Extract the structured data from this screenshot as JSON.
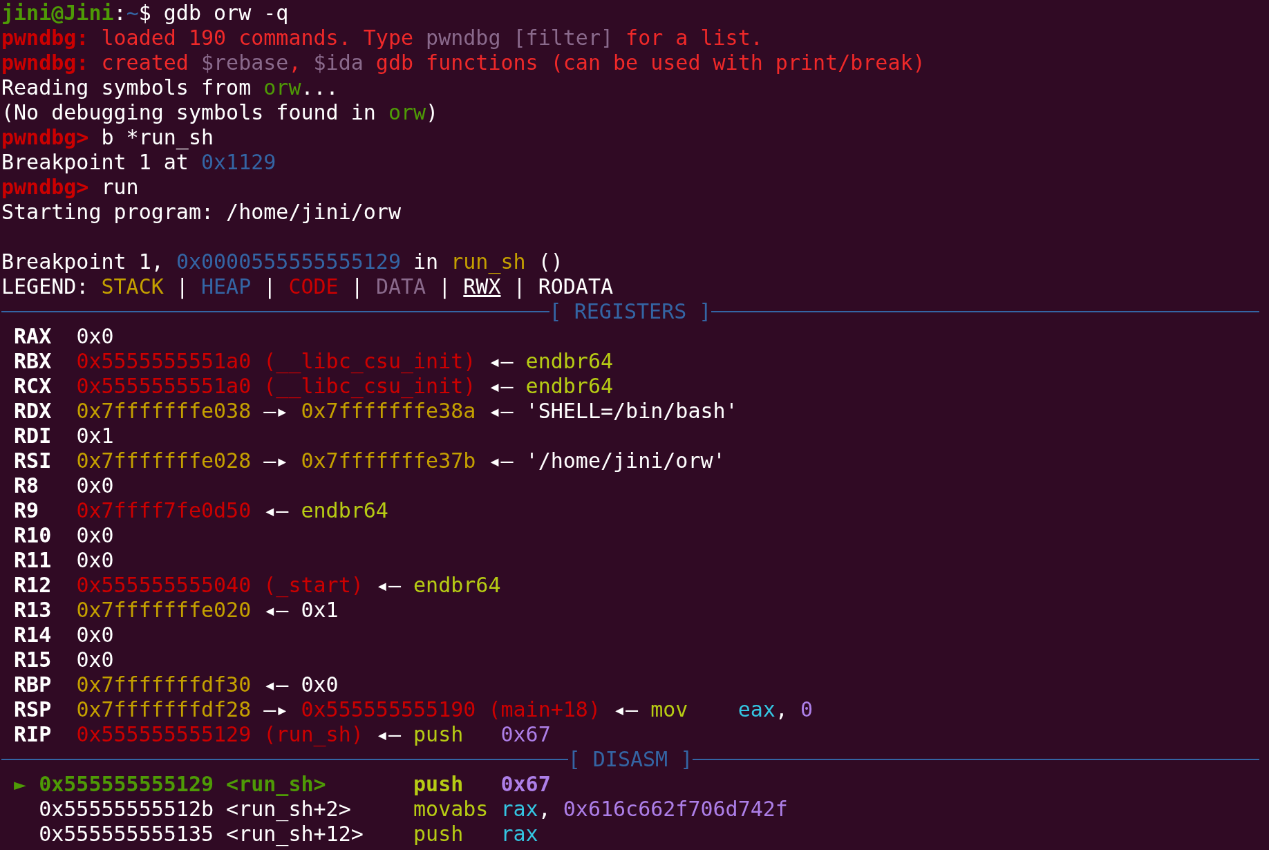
{
  "terminal": {
    "lines": [
      {
        "kind": "text",
        "segments": [
          {
            "t": "jini@Jini",
            "color": "#4e9a06",
            "bold": true,
            "underline": false
          },
          {
            "t": ":",
            "color": "#ffffff",
            "bold": false,
            "underline": false
          },
          {
            "t": "~",
            "color": "#3465a4",
            "bold": false,
            "underline": false
          },
          {
            "t": "$ gdb orw -q",
            "color": "#ffffff",
            "bold": false,
            "underline": false
          }
        ]
      },
      {
        "kind": "text",
        "segments": [
          {
            "t": "pwndbg:",
            "color": "#cc0000",
            "bold": true,
            "underline": false
          },
          {
            "t": " loaded 190 commands. Type ",
            "color": "#ef2929",
            "bold": false,
            "underline": false
          },
          {
            "t": "pwndbg [filter]",
            "color": "#8a6a8c",
            "bold": false,
            "underline": false
          },
          {
            "t": " for a list.",
            "color": "#ef2929",
            "bold": false,
            "underline": false
          }
        ]
      },
      {
        "kind": "text",
        "segments": [
          {
            "t": "pwndbg:",
            "color": "#cc0000",
            "bold": true,
            "underline": false
          },
          {
            "t": " created ",
            "color": "#ef2929",
            "bold": false,
            "underline": false
          },
          {
            "t": "$rebase",
            "color": "#8a6a8c",
            "bold": false,
            "underline": false
          },
          {
            "t": ", ",
            "color": "#ef2929",
            "bold": false,
            "underline": false
          },
          {
            "t": "$ida",
            "color": "#8a6a8c",
            "bold": false,
            "underline": false
          },
          {
            "t": " gdb functions (can be used with print/break)",
            "color": "#ef2929",
            "bold": false,
            "underline": false
          }
        ]
      },
      {
        "kind": "text",
        "segments": [
          {
            "t": "Reading symbols from ",
            "color": "#ffffff",
            "bold": false,
            "underline": false
          },
          {
            "t": "orw",
            "color": "#4e9a06",
            "bold": false,
            "underline": false
          },
          {
            "t": "...",
            "color": "#ffffff",
            "bold": false,
            "underline": false
          }
        ]
      },
      {
        "kind": "text",
        "segments": [
          {
            "t": "(No debugging symbols found in ",
            "color": "#ffffff",
            "bold": false,
            "underline": false
          },
          {
            "t": "orw",
            "color": "#4e9a06",
            "bold": false,
            "underline": false
          },
          {
            "t": ")",
            "color": "#ffffff",
            "bold": false,
            "underline": false
          }
        ]
      },
      {
        "kind": "text",
        "segments": [
          {
            "t": "pwndbg>",
            "color": "#cc0000",
            "bold": true,
            "underline": false
          },
          {
            "t": " b *run_sh",
            "color": "#ffffff",
            "bold": false,
            "underline": false
          }
        ]
      },
      {
        "kind": "text",
        "segments": [
          {
            "t": "Breakpoint 1 at ",
            "color": "#ffffff",
            "bold": false,
            "underline": false
          },
          {
            "t": "0x1129",
            "color": "#3465a4",
            "bold": false,
            "underline": false
          }
        ]
      },
      {
        "kind": "text",
        "segments": [
          {
            "t": "pwndbg>",
            "color": "#cc0000",
            "bold": true,
            "underline": false
          },
          {
            "t": " run",
            "color": "#ffffff",
            "bold": false,
            "underline": false
          }
        ]
      },
      {
        "kind": "text",
        "segments": [
          {
            "t": "Starting program: /home/jini/orw",
            "color": "#ffffff",
            "bold": false,
            "underline": false
          }
        ]
      },
      {
        "kind": "blank"
      },
      {
        "kind": "text",
        "segments": [
          {
            "t": "Breakpoint 1, ",
            "color": "#ffffff",
            "bold": false,
            "underline": false
          },
          {
            "t": "0x0000555555555129",
            "color": "#3465a4",
            "bold": false,
            "underline": false
          },
          {
            "t": " in ",
            "color": "#ffffff",
            "bold": false,
            "underline": false
          },
          {
            "t": "run_sh",
            "color": "#c4a000",
            "bold": false,
            "underline": false
          },
          {
            "t": " ()",
            "color": "#ffffff",
            "bold": false,
            "underline": false
          }
        ]
      },
      {
        "kind": "text",
        "segments": [
          {
            "t": "LEGEND: ",
            "color": "#ffffff",
            "bold": false,
            "underline": false
          },
          {
            "t": "STACK",
            "color": "#c4a000",
            "bold": false,
            "underline": false
          },
          {
            "t": " | ",
            "color": "#ffffff",
            "bold": false,
            "underline": false
          },
          {
            "t": "HEAP",
            "color": "#3465a4",
            "bold": false,
            "underline": false
          },
          {
            "t": " | ",
            "color": "#ffffff",
            "bold": false,
            "underline": false
          },
          {
            "t": "CODE",
            "color": "#cc0000",
            "bold": false,
            "underline": false
          },
          {
            "t": " | ",
            "color": "#ffffff",
            "bold": false,
            "underline": false
          },
          {
            "t": "DATA",
            "color": "#8a6a8c",
            "bold": false,
            "underline": false
          },
          {
            "t": " | ",
            "color": "#ffffff",
            "bold": false,
            "underline": false
          },
          {
            "t": "RWX",
            "color": "#ffffff",
            "bold": false,
            "underline": true
          },
          {
            "t": " | RODATA",
            "color": "#ffffff",
            "bold": false,
            "underline": false
          }
        ]
      },
      {
        "kind": "divider",
        "title": "[ REGISTERS ]"
      },
      {
        "kind": "text",
        "segments": [
          {
            "t": " RAX  ",
            "color": "#ffffff",
            "bold": true,
            "underline": false
          },
          {
            "t": "0x0",
            "color": "#ffffff",
            "bold": false,
            "underline": false
          }
        ]
      },
      {
        "kind": "text",
        "segments": [
          {
            "t": " RBX  ",
            "color": "#ffffff",
            "bold": true,
            "underline": false
          },
          {
            "t": "0x5555555551a0 (__libc_csu_init)",
            "color": "#cc0000",
            "bold": false,
            "underline": false
          },
          {
            "t": " ◂— ",
            "color": "#ffffff",
            "bold": false,
            "underline": false
          },
          {
            "t": "endbr64",
            "color": "#b7cc14",
            "bold": false,
            "underline": false
          }
        ]
      },
      {
        "kind": "text",
        "segments": [
          {
            "t": " RCX  ",
            "color": "#ffffff",
            "bold": true,
            "underline": false
          },
          {
            "t": "0x5555555551a0 (__libc_csu_init)",
            "color": "#cc0000",
            "bold": false,
            "underline": false
          },
          {
            "t": " ◂— ",
            "color": "#ffffff",
            "bold": false,
            "underline": false
          },
          {
            "t": "endbr64",
            "color": "#b7cc14",
            "bold": false,
            "underline": false
          }
        ]
      },
      {
        "kind": "text",
        "segments": [
          {
            "t": " RDX  ",
            "color": "#ffffff",
            "bold": true,
            "underline": false
          },
          {
            "t": "0x7fffffffe038",
            "color": "#c4a000",
            "bold": false,
            "underline": false
          },
          {
            "t": " —▸ ",
            "color": "#ffffff",
            "bold": false,
            "underline": false
          },
          {
            "t": "0x7fffffffe38a",
            "color": "#c4a000",
            "bold": false,
            "underline": false
          },
          {
            "t": " ◂— 'SHELL=/bin/bash'",
            "color": "#ffffff",
            "bold": false,
            "underline": false
          }
        ]
      },
      {
        "kind": "text",
        "segments": [
          {
            "t": " RDI  ",
            "color": "#ffffff",
            "bold": true,
            "underline": false
          },
          {
            "t": "0x1",
            "color": "#ffffff",
            "bold": false,
            "underline": false
          }
        ]
      },
      {
        "kind": "text",
        "segments": [
          {
            "t": " RSI  ",
            "color": "#ffffff",
            "bold": true,
            "underline": false
          },
          {
            "t": "0x7fffffffe028",
            "color": "#c4a000",
            "bold": false,
            "underline": false
          },
          {
            "t": " —▸ ",
            "color": "#ffffff",
            "bold": false,
            "underline": false
          },
          {
            "t": "0x7fffffffe37b",
            "color": "#c4a000",
            "bold": false,
            "underline": false
          },
          {
            "t": " ◂— '/home/jini/orw'",
            "color": "#ffffff",
            "bold": false,
            "underline": false
          }
        ]
      },
      {
        "kind": "text",
        "segments": [
          {
            "t": " R8   ",
            "color": "#ffffff",
            "bold": true,
            "underline": false
          },
          {
            "t": "0x0",
            "color": "#ffffff",
            "bold": false,
            "underline": false
          }
        ]
      },
      {
        "kind": "text",
        "segments": [
          {
            "t": " R9   ",
            "color": "#ffffff",
            "bold": true,
            "underline": false
          },
          {
            "t": "0x7ffff7fe0d50",
            "color": "#cc0000",
            "bold": false,
            "underline": false
          },
          {
            "t": " ◂— ",
            "color": "#ffffff",
            "bold": false,
            "underline": false
          },
          {
            "t": "endbr64",
            "color": "#b7cc14",
            "bold": false,
            "underline": false
          }
        ]
      },
      {
        "kind": "text",
        "segments": [
          {
            "t": " R10  ",
            "color": "#ffffff",
            "bold": true,
            "underline": false
          },
          {
            "t": "0x0",
            "color": "#ffffff",
            "bold": false,
            "underline": false
          }
        ]
      },
      {
        "kind": "text",
        "segments": [
          {
            "t": " R11  ",
            "color": "#ffffff",
            "bold": true,
            "underline": false
          },
          {
            "t": "0x0",
            "color": "#ffffff",
            "bold": false,
            "underline": false
          }
        ]
      },
      {
        "kind": "text",
        "segments": [
          {
            "t": " R12  ",
            "color": "#ffffff",
            "bold": true,
            "underline": false
          },
          {
            "t": "0x555555555040 (_start)",
            "color": "#cc0000",
            "bold": false,
            "underline": false
          },
          {
            "t": " ◂— ",
            "color": "#ffffff",
            "bold": false,
            "underline": false
          },
          {
            "t": "endbr64",
            "color": "#b7cc14",
            "bold": false,
            "underline": false
          }
        ]
      },
      {
        "kind": "text",
        "segments": [
          {
            "t": " R13  ",
            "color": "#ffffff",
            "bold": true,
            "underline": false
          },
          {
            "t": "0x7fffffffe020",
            "color": "#c4a000",
            "bold": false,
            "underline": false
          },
          {
            "t": " ◂— 0x1",
            "color": "#ffffff",
            "bold": false,
            "underline": false
          }
        ]
      },
      {
        "kind": "text",
        "segments": [
          {
            "t": " R14  ",
            "color": "#ffffff",
            "bold": true,
            "underline": false
          },
          {
            "t": "0x0",
            "color": "#ffffff",
            "bold": false,
            "underline": false
          }
        ]
      },
      {
        "kind": "text",
        "segments": [
          {
            "t": " R15  ",
            "color": "#ffffff",
            "bold": true,
            "underline": false
          },
          {
            "t": "0x0",
            "color": "#ffffff",
            "bold": false,
            "underline": false
          }
        ]
      },
      {
        "kind": "text",
        "segments": [
          {
            "t": " RBP  ",
            "color": "#ffffff",
            "bold": true,
            "underline": false
          },
          {
            "t": "0x7fffffffdf30",
            "color": "#c4a000",
            "bold": false,
            "underline": false
          },
          {
            "t": " ◂— 0x0",
            "color": "#ffffff",
            "bold": false,
            "underline": false
          }
        ]
      },
      {
        "kind": "text",
        "segments": [
          {
            "t": " RSP  ",
            "color": "#ffffff",
            "bold": true,
            "underline": false
          },
          {
            "t": "0x7fffffffdf28",
            "color": "#c4a000",
            "bold": false,
            "underline": false
          },
          {
            "t": " —▸ ",
            "color": "#ffffff",
            "bold": false,
            "underline": false
          },
          {
            "t": "0x555555555190 (main+18)",
            "color": "#cc0000",
            "bold": false,
            "underline": false
          },
          {
            "t": " ◂— ",
            "color": "#ffffff",
            "bold": false,
            "underline": false
          },
          {
            "t": "mov    ",
            "color": "#b7cc14",
            "bold": false,
            "underline": false
          },
          {
            "t": "eax",
            "color": "#34c6e2",
            "bold": false,
            "underline": false
          },
          {
            "t": ", ",
            "color": "#ffffff",
            "bold": false,
            "underline": false
          },
          {
            "t": "0",
            "color": "#ad7fe8",
            "bold": false,
            "underline": false
          }
        ]
      },
      {
        "kind": "text",
        "segments": [
          {
            "t": " RIP  ",
            "color": "#ffffff",
            "bold": true,
            "underline": false
          },
          {
            "t": "0x555555555129 (run_sh)",
            "color": "#cc0000",
            "bold": false,
            "underline": false
          },
          {
            "t": " ◂— ",
            "color": "#ffffff",
            "bold": false,
            "underline": false
          },
          {
            "t": "push   ",
            "color": "#b7cc14",
            "bold": false,
            "underline": false
          },
          {
            "t": "0x67",
            "color": "#ad7fe8",
            "bold": false,
            "underline": false
          }
        ]
      },
      {
        "kind": "divider",
        "title": "[ DISASM ]"
      },
      {
        "kind": "text",
        "segments": [
          {
            "t": " ► 0x555555555129 <run_sh>       ",
            "color": "#4e9a06",
            "bold": true,
            "underline": false
          },
          {
            "t": "push   ",
            "color": "#b7cc14",
            "bold": true,
            "underline": false
          },
          {
            "t": "0x67",
            "color": "#ad7fe8",
            "bold": true,
            "underline": false
          }
        ]
      },
      {
        "kind": "text",
        "segments": [
          {
            "t": "   0x55555555512b <run_sh+2>     ",
            "color": "#ffffff",
            "bold": false,
            "underline": false
          },
          {
            "t": "movabs ",
            "color": "#b7cc14",
            "bold": false,
            "underline": false
          },
          {
            "t": "rax",
            "color": "#34c6e2",
            "bold": false,
            "underline": false
          },
          {
            "t": ", ",
            "color": "#ffffff",
            "bold": false,
            "underline": false
          },
          {
            "t": "0x616c662f706d742f",
            "color": "#ad7fe8",
            "bold": false,
            "underline": false
          }
        ]
      },
      {
        "kind": "text",
        "segments": [
          {
            "t": "   0x555555555135 <run_sh+12>    ",
            "color": "#ffffff",
            "bold": false,
            "underline": false
          },
          {
            "t": "push   ",
            "color": "#b7cc14",
            "bold": false,
            "underline": false
          },
          {
            "t": "rax",
            "color": "#34c6e2",
            "bold": false,
            "underline": false
          }
        ]
      }
    ]
  }
}
